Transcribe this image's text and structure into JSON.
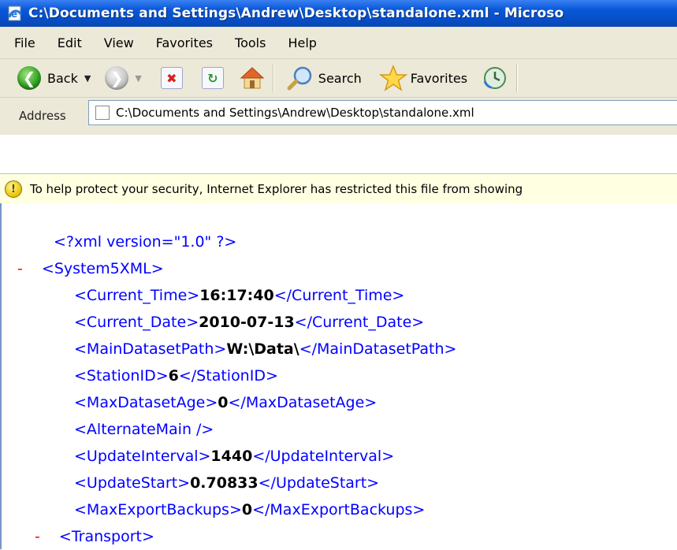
{
  "window": {
    "title": "C:\\Documents and Settings\\Andrew\\Desktop\\standalone.xml - Microso"
  },
  "menu": [
    "File",
    "Edit",
    "View",
    "Favorites",
    "Tools",
    "Help"
  ],
  "toolbar": {
    "back_label": "Back",
    "search_label": "Search",
    "favorites_label": "Favorites"
  },
  "address": {
    "label": "Address",
    "url": "C:\\Documents and Settings\\Andrew\\Desktop\\standalone.xml"
  },
  "infobar": {
    "text": "To help protect your security, Internet Explorer has restricted this file from showing"
  },
  "xml": {
    "declaration": "<?xml version=\"1.0\" ?>",
    "collapse_symbol": "-",
    "root_open": "<System5XML>",
    "elements": [
      {
        "open": "<Current_Time>",
        "value": "16:17:40",
        "close": "</Current_Time>"
      },
      {
        "open": "<Current_Date>",
        "value": "2010-07-13",
        "close": "</Current_Date>"
      },
      {
        "open": "<MainDatasetPath>",
        "value": "W:\\Data\\",
        "close": "</MainDatasetPath>"
      },
      {
        "open": "<StationID>",
        "value": "6",
        "close": "</StationID>"
      },
      {
        "open": "<MaxDatasetAge>",
        "value": "0",
        "close": "</MaxDatasetAge>"
      },
      {
        "open": "<AlternateMain />",
        "value": "",
        "close": ""
      },
      {
        "open": "<UpdateInterval>",
        "value": "1440",
        "close": "</UpdateInterval>"
      },
      {
        "open": "<UpdateStart>",
        "value": "0.70833",
        "close": "</UpdateStart>"
      },
      {
        "open": "<MaxExportBackups>",
        "value": "0",
        "close": "</MaxExportBackups>"
      }
    ],
    "transport_open": "<Transport>"
  }
}
